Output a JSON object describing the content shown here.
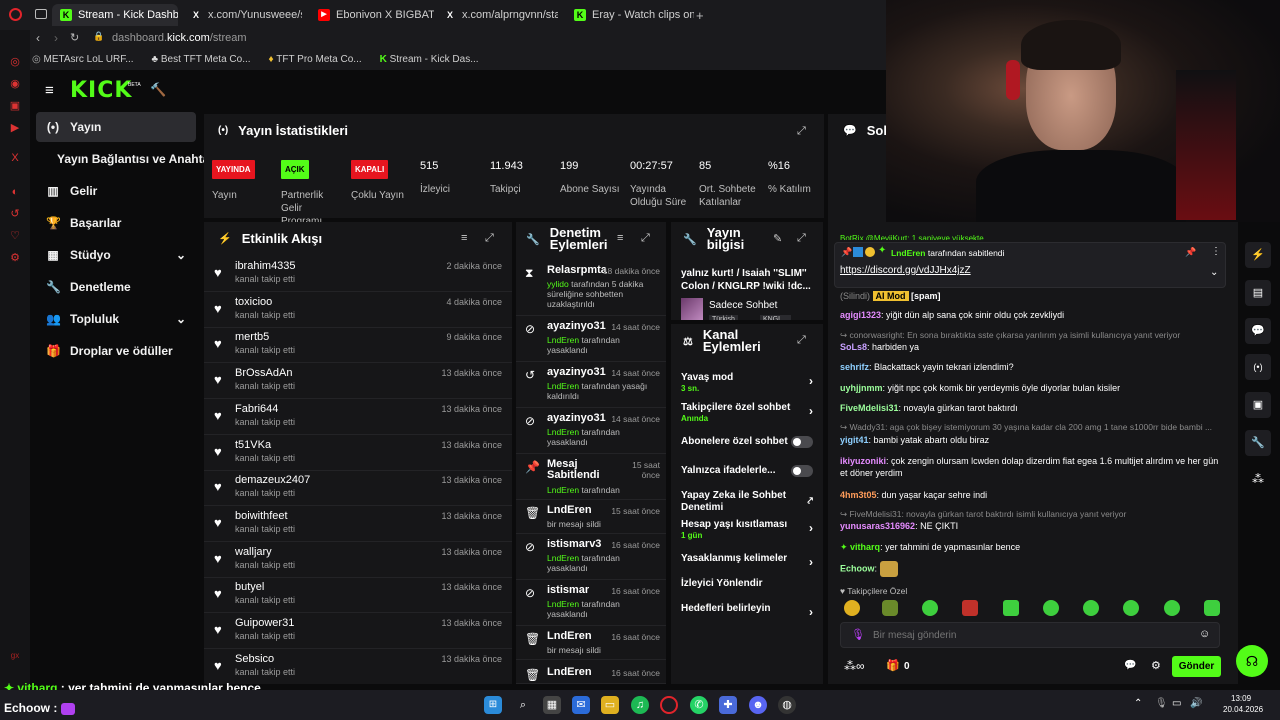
{
  "browser": {
    "tabs": [
      {
        "label": "Stream - Kick Dashboard",
        "active": true
      },
      {
        "label": "x.com/Yunusweee/status"
      },
      {
        "label": "Ebonivon X BIGBAT - TAM"
      },
      {
        "label": "x.com/alprngvnn/status/2"
      },
      {
        "label": "Eray - Watch clips on Kick"
      }
    ],
    "url_prefix": "dashboard.",
    "url_host": "kick.com",
    "url_path": "/stream",
    "bookmarks": [
      "METAsrc LoL URF...",
      "Best TFT Meta Co...",
      "TFT Pro Meta Co...",
      "Stream - Kick Das..."
    ]
  },
  "header": {
    "logo": "KICK",
    "beta": "BETA"
  },
  "nav": {
    "items": [
      {
        "label": "Yayın",
        "icon": "broadcast-icon"
      },
      {
        "label": "Yayın Bağlantısı ve Anahtarı"
      },
      {
        "label": "Gelir",
        "icon": "revenue-icon"
      },
      {
        "label": "Başarılar",
        "icon": "trophy-icon"
      },
      {
        "label": "Stüdyo",
        "icon": "studio-icon"
      },
      {
        "label": "Denetleme",
        "icon": "wrench-icon"
      },
      {
        "label": "Topluluk",
        "icon": "users-icon"
      },
      {
        "label": "Droplar ve ödüller",
        "icon": "drops-icon"
      }
    ]
  },
  "stats": {
    "title": "Yayın İstatistikleri",
    "items": [
      {
        "badge": "YAYINDA",
        "label": "Yayın"
      },
      {
        "badge": "AÇIK",
        "label": "Partnerlik Gelir Programı"
      },
      {
        "badge": "KAPALI",
        "label": "Çoklu Yayın"
      },
      {
        "value": "515",
        "label": "İzleyici"
      },
      {
        "value": "11.943",
        "label": "Takipçi"
      },
      {
        "value": "199",
        "label": "Abone Sayısı"
      },
      {
        "value": "00:27:57",
        "label": "Yayında Olduğu Süre"
      },
      {
        "value": "85",
        "label": "Ort. Sohbete Katılanlar"
      },
      {
        "value": "%16",
        "label": "% Katılım"
      }
    ]
  },
  "activity": {
    "title": "Etkinlik Akışı",
    "rows": [
      {
        "user": "ibrahim4335",
        "sub": "kanalı takip etti",
        "time": "2 dakika önce"
      },
      {
        "user": "toxicioo",
        "sub": "kanalı takip etti",
        "time": "4 dakika önce"
      },
      {
        "user": "mertb5",
        "sub": "kanalı takip etti",
        "time": "9 dakika önce"
      },
      {
        "user": "BrOssAdAn",
        "sub": "kanalı takip etti",
        "time": "13 dakika önce"
      },
      {
        "user": "Fabri644",
        "sub": "kanalı takip etti",
        "time": "13 dakika önce"
      },
      {
        "user": "t51VKa",
        "sub": "kanalı takip etti",
        "time": "13 dakika önce"
      },
      {
        "user": "demazeux2407",
        "sub": "kanalı takip etti",
        "time": "13 dakika önce"
      },
      {
        "user": "boiwithfeet",
        "sub": "kanalı takip etti",
        "time": "13 dakika önce"
      },
      {
        "user": "walljary",
        "sub": "kanalı takip etti",
        "time": "13 dakika önce"
      },
      {
        "user": "butyel",
        "sub": "kanalı takip etti",
        "time": "13 dakika önce"
      },
      {
        "user": "Guipower31",
        "sub": "kanalı takip etti",
        "time": "13 dakika önce"
      },
      {
        "user": "Sebsico",
        "sub": "kanalı takip etti",
        "time": "13 dakika önce"
      }
    ]
  },
  "moderation": {
    "title": "Denetim Eylemleri",
    "rows": [
      {
        "user": "Relasrpmta",
        "time": "18 dakika önce",
        "mod": "yylido",
        "desc": "tarafından 5 dakika süreliğine sohbetten uzaklaştırıldı"
      },
      {
        "user": "ayazinyo31",
        "time": "14 saat önce",
        "mod": "LndEren",
        "desc": "tarafından yasaklandı"
      },
      {
        "user": "ayazinyo31",
        "time": "14 saat önce",
        "mod": "LndEren",
        "desc": "tarafından yasağı kaldırıldı"
      },
      {
        "user": "ayazinyo31",
        "time": "14 saat önce",
        "mod": "LndEren",
        "desc": "tarafından yasaklandı"
      },
      {
        "user": "Mesaj Sabitlendi",
        "time": "15 saat önce",
        "mod": "LndEren",
        "desc": "tarafından"
      },
      {
        "user": "LndEren",
        "time": "15 saat önce",
        "mod": "",
        "desc": "bir mesajı sildi"
      },
      {
        "user": "istismarv3",
        "time": "16 saat önce",
        "mod": "LndEren",
        "desc": "tarafından yasaklandı"
      },
      {
        "user": "istismar",
        "time": "16 saat önce",
        "mod": "LndEren",
        "desc": "tarafından yasaklandı"
      },
      {
        "user": "LndEren",
        "time": "16 saat önce",
        "mod": "",
        "desc": "bir mesajı sildi"
      },
      {
        "user": "LndEren",
        "time": "16 saat önce",
        "mod": "",
        "desc": ""
      }
    ]
  },
  "streaminfo": {
    "title": "Yayın bilgisi",
    "stream_title": "yalnız kurt! / Isaiah ''SLIM'' Colon / KNGLRP !wiki !dc...",
    "category": "Sadece Sohbet",
    "tags": [
      "Türkish",
      "KNGL..."
    ]
  },
  "channel_actions": {
    "title": "Kanal Eylemleri",
    "rows": [
      {
        "label": "Yavaş mod",
        "sub": "3 sn.",
        "kind": "chevron"
      },
      {
        "label": "Takipçilere özel sohbet",
        "sub": "Anında",
        "kind": "chevron"
      },
      {
        "label": "Abonelere özel sohbet",
        "sub": "",
        "kind": "toggle"
      },
      {
        "label": "Yalnızca ifadelerle...",
        "sub": "",
        "kind": "toggle"
      },
      {
        "label": "Yapay Zeka ile Sohbet Denetimi",
        "sub": "",
        "kind": "external"
      },
      {
        "label": "Hesap yaşı kısıtlaması",
        "sub": "1 gün",
        "kind": "chevron"
      },
      {
        "label": "Yasaklanmış kelimeler",
        "sub": "",
        "kind": "chevron"
      },
      {
        "label": "İzleyici Yönlendir",
        "sub": "",
        "kind": "none"
      },
      {
        "label": "Hedefleri belirleyin",
        "sub": "",
        "kind": "chevron"
      }
    ]
  },
  "chat": {
    "title": "Soh",
    "top_line": "BotRix @MeviiKurt: 1 saniyeye yüksekte",
    "pinned_by": "LndEren",
    "pinned_suffix": "tarafından sabitlendi",
    "pinned_link": "https://discord.gg/vdJJHx4jzZ",
    "removed": "(Silindi)",
    "ai_mod": "AI Mod",
    "spam": "[spam]",
    "messages": [
      {
        "user": "agigi1323",
        "text": "yiğit dün alp sana çok sinir oldu çok zevkliydi",
        "color": "#e58cff"
      },
      {
        "reply": "conorwasright: En sona bıraktıkta sste çıkarsa yarılırım ya isimli kullanıcıya yanıt veriyor"
      },
      {
        "user": "SoLs8",
        "text": "harbiden ya",
        "color": "#c8a0ff"
      },
      {
        "user": "sehrifz",
        "text": "Blackattack yayin tekrari izlendimi?",
        "color": "#8fd0ff"
      },
      {
        "user": "uyhjjnmm",
        "text": "yiğit npc çok komik bir yerdeymis öyle diyorlar bulan kisiler",
        "color": "#9cff9c"
      },
      {
        "user": "FiveMdelisi31",
        "text": "novayla gürkan tarot baktırdı",
        "color": "#9cff9c"
      },
      {
        "reply": "Waddy31: aga çok bişey istemiyorum 30 yaşına kadar cla 200 amg 1 tane s1000rr bide bambi ..."
      },
      {
        "user": "yigit41",
        "text": "bambi yatak abartı oldu biraz",
        "color": "#8fd0ff"
      },
      {
        "user": "ikiyuzoniki",
        "text": "çok zengin olursam lcwden dolap dizerdim fiat egea 1.6 multijet alırdım ve her gün et döner yerdim",
        "color": "#e58cff"
      },
      {
        "user": "4hm3t05",
        "text": "dun yaşar kaçar sehre indi",
        "color": "#ff9c5a"
      },
      {
        "reply": "FiveMdelisi31: novayla gürkan tarot baktırdı isimli kullanıcıya yanıt veriyor"
      },
      {
        "user": "yunusaras316962",
        "text": "NE ÇIKTI",
        "color": "#e58cff"
      },
      {
        "user": "vitharq",
        "text": "yer tahmini de yapmasınlar bence",
        "color": "#53fc18"
      },
      {
        "user": "Echoow",
        "text": "",
        "color": "#9cff9c"
      }
    ],
    "followers_only": "Takipçilere Özel",
    "input_placeholder": "Bir mesaj gönderin",
    "points": "0",
    "send": "Gönder"
  },
  "overlay": {
    "line1_user": "vitharq",
    "line1_text": " : yer tahmini de yapmasınlar bence",
    "line2_user": "Echoow",
    "line2_sep": " :"
  },
  "taskbar": {
    "time": "13:09",
    "date": "20.04.2026"
  },
  "colors": {
    "accent": "#53fc18",
    "live": "#e7151f",
    "panel": "#161618"
  }
}
